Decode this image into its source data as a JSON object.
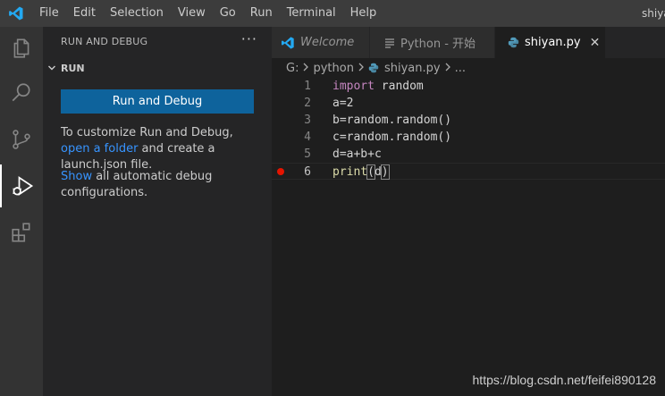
{
  "titlebar": {
    "menu": [
      "File",
      "Edit",
      "Selection",
      "View",
      "Go",
      "Run",
      "Terminal",
      "Help"
    ],
    "window_title": "shiya"
  },
  "activitybar": {
    "items": [
      "explorer-icon",
      "search-icon",
      "source-control-icon",
      "run-debug-icon",
      "extensions-icon"
    ],
    "active": "run-debug-icon"
  },
  "sidebar": {
    "title": "RUN AND DEBUG",
    "more": "···",
    "section": "RUN",
    "button_label": "Run and Debug",
    "customize_prefix": "To customize Run and Debug, ",
    "customize_link": "open a folder",
    "customize_suffix": " and create a launch.json file.",
    "show_link": "Show",
    "show_suffix": " all automatic debug configurations."
  },
  "tabs": [
    {
      "label": "Welcome",
      "icon": "vscode-logo-icon"
    },
    {
      "label": "Python - 开始",
      "icon": "preview-icon"
    },
    {
      "label": "shiyan.py",
      "icon": "python-icon",
      "close": "✕"
    }
  ],
  "breadcrumb": [
    "G:",
    "python",
    "shiyan.py",
    "..."
  ],
  "editor": {
    "lines": [
      {
        "n": "1",
        "text": "import random"
      },
      {
        "n": "2",
        "text": "a=2"
      },
      {
        "n": "3",
        "text": "b=random.random()"
      },
      {
        "n": "4",
        "text": "c=random.random()"
      },
      {
        "n": "5",
        "text": "d=a+b+c"
      },
      {
        "n": "6",
        "text": "print(d)"
      }
    ],
    "breakpoint_line": 6,
    "current_line": 6
  },
  "watermark": "https://blog.csdn.net/feifei890128",
  "colors": {
    "accent": "#0e639c",
    "link": "#3794ff",
    "breakpoint": "#e51400",
    "keyword": "#c586c0",
    "function": "#dcdcaa"
  }
}
